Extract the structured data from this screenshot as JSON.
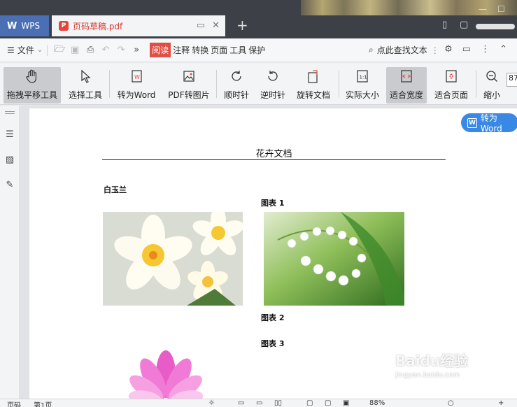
{
  "app": {
    "wps_tab_label": "WPS",
    "doc_tab_name": "页码草稿.pdf"
  },
  "menubar": {
    "file_label": "文件",
    "items": [
      "阅读",
      "注释",
      "转换",
      "页面",
      "工具",
      "保护"
    ],
    "active_item": "阅读",
    "search_label": "点此查找文本"
  },
  "toolbar": {
    "tools": [
      {
        "label": "拖拽平移工具",
        "icon": "hand-icon",
        "active": true
      },
      {
        "label": "选择工具",
        "icon": "cursor-icon",
        "active": false
      },
      {
        "label": "转为Word",
        "icon": "word-convert-icon",
        "active": false
      },
      {
        "label": "PDF转图片",
        "icon": "image-convert-icon",
        "active": false
      },
      {
        "label": "顺时针",
        "icon": "rotate-cw-icon",
        "active": false
      },
      {
        "label": "逆时针",
        "icon": "rotate-ccw-icon",
        "active": false
      },
      {
        "label": "旋转文档",
        "icon": "rotate-doc-icon",
        "active": false
      },
      {
        "label": "实际大小",
        "icon": "actual-size-icon",
        "active": false
      },
      {
        "label": "适合宽度",
        "icon": "fit-width-icon",
        "active": true
      },
      {
        "label": "适合页面",
        "icon": "fit-page-icon",
        "active": false
      },
      {
        "label": "缩小",
        "icon": "zoom-out-icon",
        "active": false
      }
    ],
    "zoom_value_partial": "87"
  },
  "floating": {
    "convert_word_label": "转为Word"
  },
  "document": {
    "title": "花卉文档",
    "section_label": "白玉兰",
    "captions": [
      "图表 1",
      "图表 2",
      "图表 3"
    ]
  },
  "statusbar": {
    "page_label": "页码",
    "page_value": "第1页",
    "zoom": "88%"
  },
  "watermark": {
    "main": "Baidu经验",
    "sub": "jingyan.baidu.com"
  },
  "colors": {
    "accent_blue": "#3a88e5",
    "accent_red": "#e04e44",
    "titlebar": "#3d4147"
  }
}
